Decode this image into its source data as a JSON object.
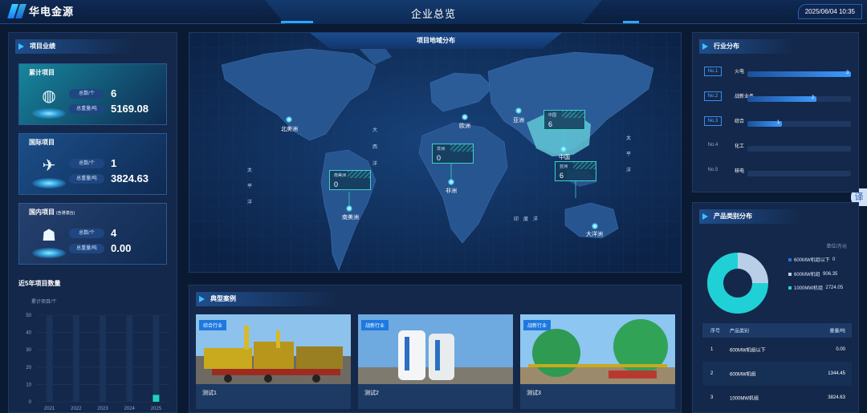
{
  "header": {
    "logo_text": "华电金源",
    "title": "企业总览",
    "datetime": "2025/06/04 10:35",
    "translate_label": "译"
  },
  "left": {
    "section_title": "项目业绩",
    "cards": [
      {
        "title": "累计项目",
        "subtitle": "",
        "icon": "globe-icon",
        "count_label": "总数/个",
        "count": "6",
        "output_label": "总重量/吨",
        "output": "5169.08",
        "bg": "#16869c"
      },
      {
        "title": "国际项目",
        "subtitle": "",
        "icon": "plane-globe-icon",
        "count_label": "总数/个",
        "count": "1",
        "output_label": "总重量/吨",
        "output": "3824.63",
        "bg": "#1b4f8a"
      },
      {
        "title": "国内项目",
        "subtitle": "(含港澳台)",
        "icon": "china-map-icon",
        "count_label": "总数/个",
        "count": "4",
        "output_label": "总重量/吨",
        "output": "0.00",
        "bg": "#27416f"
      }
    ],
    "years_title": "近5年项目数量",
    "years_unit": "累计项目/个"
  },
  "map": {
    "title": "项目地域分布",
    "regions": [
      {
        "name": "北美洲"
      },
      {
        "name": "南美洲"
      },
      {
        "name": "欧洲"
      },
      {
        "name": "非洲"
      },
      {
        "name": "亚洲"
      },
      {
        "name": "中国"
      },
      {
        "name": "大洋洲"
      }
    ],
    "oceans": [
      "大",
      "西",
      "洋",
      "太",
      "平",
      "洋",
      "太",
      "平",
      "洋",
      "印",
      "度",
      "洋"
    ],
    "tags": [
      {
        "label": "南美洲",
        "value": "0"
      },
      {
        "label": "非洲",
        "value": "0"
      },
      {
        "label": "中国",
        "value": "6"
      },
      {
        "label": "亚洲",
        "value": "6"
      }
    ]
  },
  "cases": {
    "title": "典型案例",
    "items": [
      {
        "tag": "综合行业",
        "label": "测试1"
      },
      {
        "tag": "战新行业",
        "label": "测试2"
      },
      {
        "tag": "战新行业",
        "label": "测试3"
      }
    ]
  },
  "industry": {
    "title": "行业分布",
    "items": [
      {
        "rank": "No.1",
        "name": "火电",
        "value": 3
      },
      {
        "rank": "No.2",
        "name": "战新业务",
        "value": 2
      },
      {
        "rank": "No.3",
        "name": "综合",
        "value": 1
      },
      {
        "rank": "No.4",
        "name": "化工",
        "value": 0
      },
      {
        "rank": "No.5",
        "name": "核电",
        "value": 0
      }
    ],
    "max": 3,
    "bar_color": "#3d9bff"
  },
  "product": {
    "title": "产品类别分布",
    "unit": "单位/万元",
    "legend": [
      {
        "name": "600MW机组以下",
        "value": "0",
        "color": "#1e78e0"
      },
      {
        "name": "600MW机组",
        "value": "906.35",
        "color": "#b9cfe8"
      },
      {
        "name": "1000MW机组",
        "value": "2724.05",
        "color": "#1fd1d6"
      }
    ],
    "table_headers": [
      "序号",
      "产品类别",
      "重量/吨"
    ],
    "table_rows": [
      [
        "1",
        "600MW机组以下",
        "0.00"
      ],
      [
        "2",
        "600MW机组",
        "1344.45"
      ],
      [
        "3",
        "1000MW机组",
        "3824.63"
      ]
    ]
  },
  "chart_data": {
    "type": "bar",
    "title": "近5年项目数量",
    "ylabel": "累计项目/个",
    "categories": [
      "2021",
      "2022",
      "2023",
      "2024",
      "2025"
    ],
    "values": [
      0,
      0,
      0,
      0,
      4
    ],
    "ylim": [
      0,
      50
    ],
    "yticks": [
      0,
      10,
      20,
      30,
      40,
      50
    ],
    "bar_color": "#1fd1c0"
  }
}
